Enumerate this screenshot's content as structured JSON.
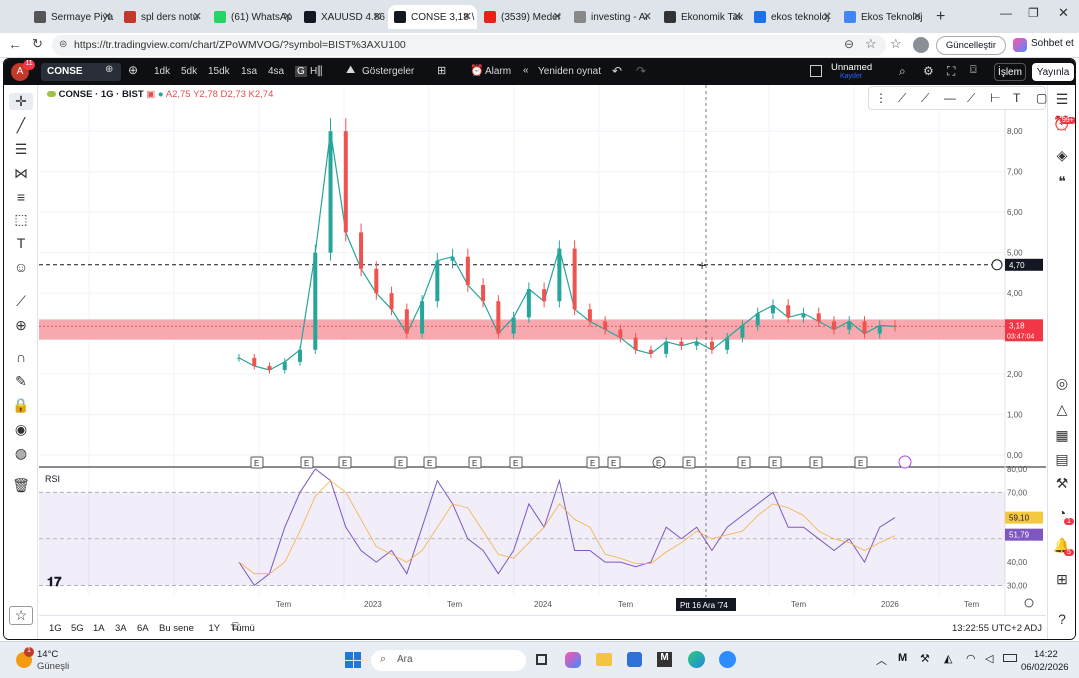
{
  "browser": {
    "tabs": [
      {
        "label": "Sermaye Piya",
        "color": "#555"
      },
      {
        "label": "spl ders notu",
        "color": "#c0392b"
      },
      {
        "label": "(61) WhatsAp",
        "color": "#25d366"
      },
      {
        "label": "XAUUSD 4.86",
        "color": "#131722"
      },
      {
        "label": "CONSE 3,18 \\",
        "color": "#131722"
      },
      {
        "label": "(3539) Meder",
        "color": "#e62117"
      },
      {
        "label": "investing - Ar",
        "color": "#888"
      },
      {
        "label": "Ekonomik Tak",
        "color": "#333"
      },
      {
        "label": "ekos teknoloj",
        "color": "#1a73e8"
      },
      {
        "label": "Ekos Teknoloj",
        "color": "#4285f4"
      }
    ],
    "url": "https://tr.tradingview.com/chart/ZPoWMVOG/?symbol=BIST%3AXU100",
    "update_label": "Güncelleştir",
    "chat_label": "Sohbet et"
  },
  "toolbar": {
    "symbol": "CONSE",
    "intervals": [
      "1dk",
      "5dk",
      "15dk",
      "1sa",
      "4sa",
      "G",
      "H"
    ],
    "indicators_label": "Göstergeler",
    "alarm_label": "Alarm",
    "replay_label": "Yeniden oynat",
    "layout_name": "Unnamed",
    "layout_sub": "Kaydet",
    "trade_label": "İşlem",
    "publish_label": "Yayınla",
    "avatar_letter": "A",
    "avatar_badge": "11"
  },
  "legend": {
    "title": "CONSE · 1G · BIST",
    "a": "A2,75",
    "y": "Y2,78",
    "d": "D2,73",
    "k": "K2,74"
  },
  "price_axis": {
    "ticks": [
      "8,00",
      "7,00",
      "6,00",
      "5,00",
      "4,00",
      "2,00",
      "1,00",
      "0,00"
    ],
    "hline_label": "4,70",
    "price_label": "3,18",
    "countdown": "03:47:04"
  },
  "rsi": {
    "label": "RSI",
    "ticks": [
      "80,00",
      "70,00",
      "40,00",
      "30,00"
    ],
    "value1": "59,10",
    "value2": "51,79"
  },
  "time_axis": {
    "labels": [
      "Tem",
      "2023",
      "Tem",
      "2024",
      "Tem",
      "Tem",
      "2026",
      "Tem"
    ],
    "crosshair_label": "Ptt 16 Ara '74"
  },
  "bottom_bar": {
    "ranges": [
      "1G",
      "5G",
      "1A",
      "3A",
      "6A",
      "Bu sene",
      "1Y",
      "Tümü"
    ],
    "clock": "13:22:55 UTC+2",
    "adj": "ADJ"
  },
  "right_badges": {
    "notif": "99+",
    "b2": "1",
    "b3": "5"
  },
  "taskbar": {
    "weather_temp": "14°C",
    "weather_desc": "Güneşli",
    "search_placeholder": "Ara",
    "time": "14:22",
    "date": "06/02/2026"
  },
  "chart_data": {
    "type": "line",
    "title": "CONSE · 1G · BIST",
    "x": [
      "2022-07",
      "2022-08",
      "2022-09",
      "2022-10",
      "2022-11",
      "2022-12",
      "2023-01",
      "2023-02",
      "2023-03",
      "2023-04",
      "2023-05",
      "2023-06",
      "2023-07",
      "2023-08",
      "2023-09",
      "2023-10",
      "2023-11",
      "2023-12",
      "2024-01",
      "2024-02",
      "2024-03",
      "2024-04",
      "2024-05",
      "2024-06",
      "2024-07",
      "2024-08",
      "2024-09",
      "2024-10",
      "2024-11",
      "2024-12",
      "2025-01",
      "2025-02",
      "2025-03",
      "2025-04",
      "2025-05",
      "2025-06",
      "2025-07",
      "2025-08",
      "2025-09",
      "2025-10",
      "2025-11",
      "2025-12",
      "2026-01",
      "2026-02"
    ],
    "series": [
      {
        "values": [
          2.4,
          2.2,
          2.1,
          2.3,
          2.6,
          5.0,
          8.0,
          5.5,
          4.6,
          4.0,
          3.6,
          3.0,
          3.8,
          4.8,
          4.9,
          4.2,
          3.8,
          3.0,
          3.4,
          4.1,
          3.8,
          5.1,
          3.6,
          3.3,
          3.1,
          2.9,
          2.6,
          2.5,
          2.8,
          2.7,
          2.8,
          2.6,
          2.9,
          3.2,
          3.5,
          3.7,
          3.4,
          3.5,
          3.3,
          3.1,
          3.3,
          3.0,
          3.2,
          3.18
        ]
      },
      {
        "name": "RSI",
        "values": [
          40,
          30,
          35,
          55,
          70,
          80,
          75,
          55,
          45,
          40,
          45,
          35,
          55,
          75,
          65,
          50,
          45,
          35,
          45,
          65,
          55,
          75,
          45,
          45,
          40,
          40,
          38,
          40,
          55,
          50,
          55,
          45,
          55,
          60,
          65,
          70,
          55,
          55,
          50,
          45,
          50,
          40,
          55,
          59.1
        ]
      }
    ],
    "horizontal_line": 4.7,
    "current_price": 3.18,
    "zone": [
      2.85,
      3.35
    ],
    "ylim": [
      0,
      8.5
    ],
    "rsi_band": [
      30,
      70
    ],
    "rsi_ylim": [
      25,
      80
    ]
  }
}
